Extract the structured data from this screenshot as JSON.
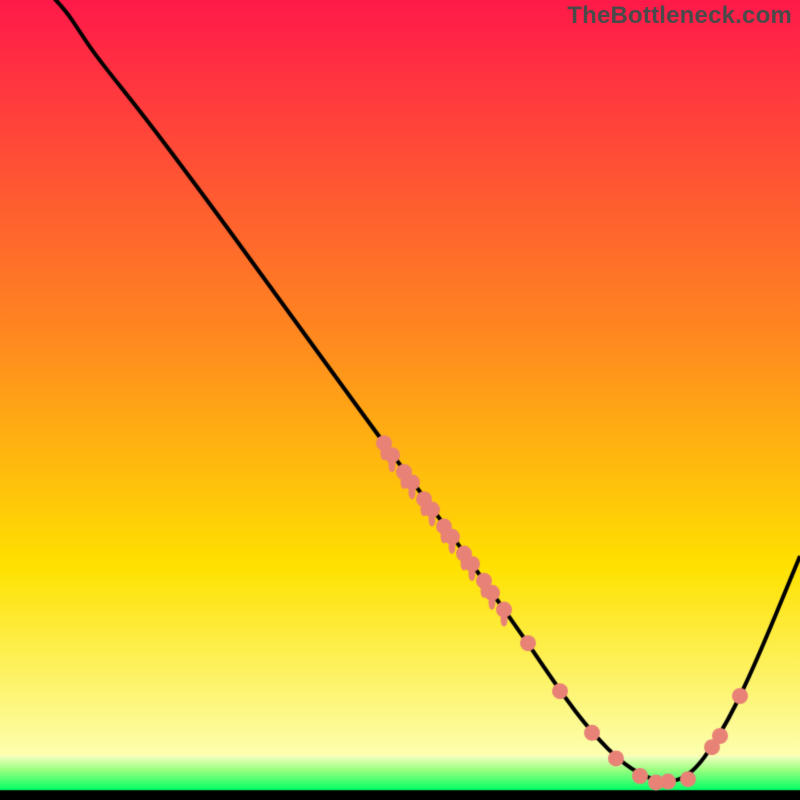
{
  "watermark": "TheBottleneck.com",
  "colors": {
    "top": "#ff1a4a",
    "mid": "#ffe200",
    "bottom_band": "#00ff66",
    "bottom_line": "#000000",
    "curve": "#000000",
    "marker_fill": "#e88277",
    "marker_stroke": "#e88277"
  },
  "chart_data": {
    "type": "line",
    "title": "",
    "xlabel": "",
    "ylabel": "",
    "xlim": [
      0,
      100
    ],
    "ylim": [
      0,
      100
    ],
    "curve": {
      "x": [
        0,
        4,
        8,
        10,
        12,
        18,
        25,
        32,
        40,
        48,
        56,
        62,
        66,
        70,
        74,
        78,
        82,
        86,
        90,
        94,
        100
      ],
      "y": [
        106,
        103,
        99,
        96,
        93,
        85.5,
        76.2,
        66.6,
        55.6,
        44.6,
        33.8,
        25.2,
        19.6,
        13.6,
        8.4,
        4.4,
        2.2,
        2.6,
        8.0,
        16.0,
        30.5
      ]
    },
    "series": [
      {
        "name": "markers-mid",
        "x": [
          48.0,
          49.0,
          50.5,
          51.5,
          53.0,
          54.0,
          55.5,
          56.5,
          58.0,
          59.0,
          60.5,
          61.5,
          63.0
        ],
        "y": [
          44.6,
          43.1,
          41.0,
          39.7,
          37.6,
          36.3,
          34.2,
          32.9,
          30.8,
          29.5,
          27.4,
          25.9,
          23.8
        ]
      },
      {
        "name": "markers-valley",
        "x": [
          66.0,
          70.0,
          74.0,
          77.0,
          80.0,
          82.0,
          83.5,
          86.0,
          89.0
        ],
        "y": [
          19.6,
          13.6,
          8.4,
          5.2,
          3.0,
          2.2,
          2.3,
          2.6,
          6.6
        ]
      },
      {
        "name": "markers-rise",
        "x": [
          90.0,
          92.5
        ],
        "y": [
          8.0,
          13.0
        ]
      }
    ],
    "bands": {
      "green_top": 5.5,
      "black_bottom": 1.2
    }
  }
}
